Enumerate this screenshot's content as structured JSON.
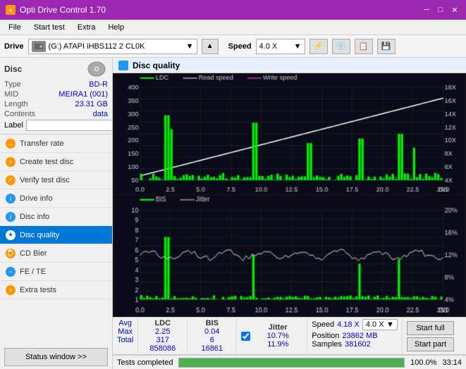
{
  "window": {
    "title": "Opti Drive Control 1.70",
    "icon": "disc-icon"
  },
  "titlebar": {
    "minimize": "─",
    "maximize": "□",
    "close": "✕"
  },
  "menubar": {
    "items": [
      "File",
      "Start test",
      "Extra",
      "Help"
    ]
  },
  "drivebar": {
    "drive_label": "Drive",
    "drive_value": "(G:) ATAPI iHBS112  2 CL0K",
    "speed_label": "Speed",
    "speed_value": "4.0 X"
  },
  "disc_panel": {
    "title": "Disc",
    "fields": [
      {
        "key": "Type",
        "val": "BD-R"
      },
      {
        "key": "MID",
        "val": "MEIRA1 (001)"
      },
      {
        "key": "Length",
        "val": "23.31 GB"
      },
      {
        "key": "Contents",
        "val": "data"
      }
    ],
    "label_placeholder": ""
  },
  "nav": {
    "items": [
      {
        "id": "transfer-rate",
        "label": "Transfer rate",
        "active": false
      },
      {
        "id": "create-test-disc",
        "label": "Create test disc",
        "active": false
      },
      {
        "id": "verify-test-disc",
        "label": "Verify test disc",
        "active": false
      },
      {
        "id": "drive-info",
        "label": "Drive info",
        "active": false
      },
      {
        "id": "disc-info",
        "label": "Disc info",
        "active": false
      },
      {
        "id": "disc-quality",
        "label": "Disc quality",
        "active": true
      },
      {
        "id": "cd-bier",
        "label": "CD Bier",
        "active": false
      },
      {
        "id": "fe-te",
        "label": "FE / TE",
        "active": false
      },
      {
        "id": "extra-tests",
        "label": "Extra tests",
        "active": false
      }
    ],
    "status_btn": "Status window >>"
  },
  "quality_chart": {
    "title": "Disc quality",
    "legend_top": [
      {
        "label": "LDC",
        "color": "#00cc00"
      },
      {
        "label": "Read speed",
        "color": "#ffffff"
      },
      {
        "label": "Write speed",
        "color": "#ff69b4"
      }
    ],
    "legend_bottom": [
      {
        "label": "BIS",
        "color": "#00cc00"
      },
      {
        "label": "Jitter",
        "color": "#dddddd"
      }
    ],
    "x_labels": [
      "0.0",
      "2.5",
      "5.0",
      "7.5",
      "10.0",
      "12.5",
      "15.0",
      "17.5",
      "20.0",
      "22.5",
      "25.0"
    ],
    "y_top_left": [
      "50",
      "100",
      "150",
      "200",
      "250",
      "300",
      "350",
      "400"
    ],
    "y_top_right": [
      "4X",
      "6X",
      "8X",
      "10X",
      "12X",
      "14X",
      "16X",
      "18X"
    ],
    "y_bottom_left": [
      "1",
      "2",
      "3",
      "4",
      "5",
      "6",
      "7",
      "8",
      "9",
      "10"
    ],
    "y_bottom_right": [
      "4%",
      "8%",
      "12%",
      "16%",
      "20%"
    ]
  },
  "stats": {
    "ldc_label": "LDC",
    "bis_label": "BIS",
    "jitter_label": "Jitter",
    "speed_label": "Speed",
    "jitter_checked": true,
    "rows": [
      {
        "name": "Avg",
        "ldc": "2.25",
        "bis": "0.04",
        "jitter": "10.7%"
      },
      {
        "name": "Max",
        "ldc": "317",
        "bis": "6",
        "jitter": "11.9%"
      },
      {
        "name": "Total",
        "ldc": "858086",
        "bis": "16861",
        "jitter": ""
      }
    ],
    "speed_val": "4.18 X",
    "speed_sel": "4.0 X",
    "position_label": "Position",
    "position_val": "23862 MB",
    "samples_label": "Samples",
    "samples_val": "381602"
  },
  "buttons": {
    "start_full": "Start full",
    "start_part": "Start part"
  },
  "progress": {
    "value": 100,
    "text": "100.0%",
    "time": "33:14"
  },
  "statusbar": {
    "text": "Tests completed"
  }
}
